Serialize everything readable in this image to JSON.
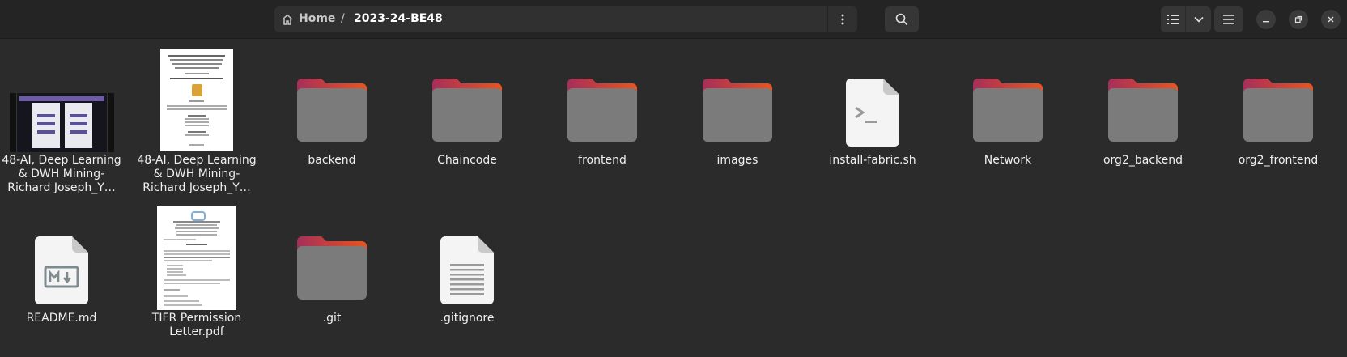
{
  "breadcrumb": {
    "home": "Home",
    "separator": "/",
    "current": "2023-24-BE48"
  },
  "toolbar": {
    "path_menu_icon": "kebab-menu-icon",
    "search_icon": "search-icon",
    "list_view_icon": "list-view-icon",
    "view_dropdown_icon": "chevron-down-icon",
    "main_menu_icon": "hamburger-icon"
  },
  "window_controls": {
    "minimize_icon": "minimize-icon",
    "maximize_icon": "maximize-icon",
    "close_icon": "close-icon"
  },
  "colors": {
    "background": "#2b2b2b",
    "folder_body": "#7b7b7b",
    "folder_tab_start": "#a62f5a",
    "folder_tab_end": "#e9541f"
  },
  "files": [
    {
      "name": "48-AI, Deep Learning & DWH Mining-Richard Joseph_Y…",
      "line1": "48-AI, Deep Learning",
      "line2": "& DWH Mining-",
      "line3": "Richard Joseph_Y…",
      "kind": "video"
    },
    {
      "name": "48-AI, Deep Learning & DWH Mining-Richard Joseph_Y…",
      "line1": "48-AI, Deep Learning",
      "line2": "& DWH Mining-",
      "line3": "Richard Joseph_Y…",
      "kind": "pdf"
    },
    {
      "name": "backend",
      "line1": "backend",
      "kind": "folder"
    },
    {
      "name": "Chaincode",
      "line1": "Chaincode",
      "kind": "folder"
    },
    {
      "name": "frontend",
      "line1": "frontend",
      "kind": "folder"
    },
    {
      "name": "images",
      "line1": "images",
      "kind": "folder"
    },
    {
      "name": "install-fabric.sh",
      "line1": "install-fabric.sh",
      "kind": "script"
    },
    {
      "name": "Network",
      "line1": "Network",
      "kind": "folder"
    },
    {
      "name": "org2_backend",
      "line1": "org2_backend",
      "kind": "folder"
    },
    {
      "name": "org2_frontend",
      "line1": "org2_frontend",
      "kind": "folder"
    },
    {
      "name": "README.md",
      "line1": "README.md",
      "kind": "markdown"
    },
    {
      "name": "TIFR Permission Letter.pdf",
      "line1": "TIFR Permission",
      "line2": "Letter.pdf",
      "kind": "pdf"
    },
    {
      "name": ".git",
      "line1": ".git",
      "kind": "folder"
    },
    {
      "name": ".gitignore",
      "line1": ".gitignore",
      "kind": "text"
    }
  ]
}
